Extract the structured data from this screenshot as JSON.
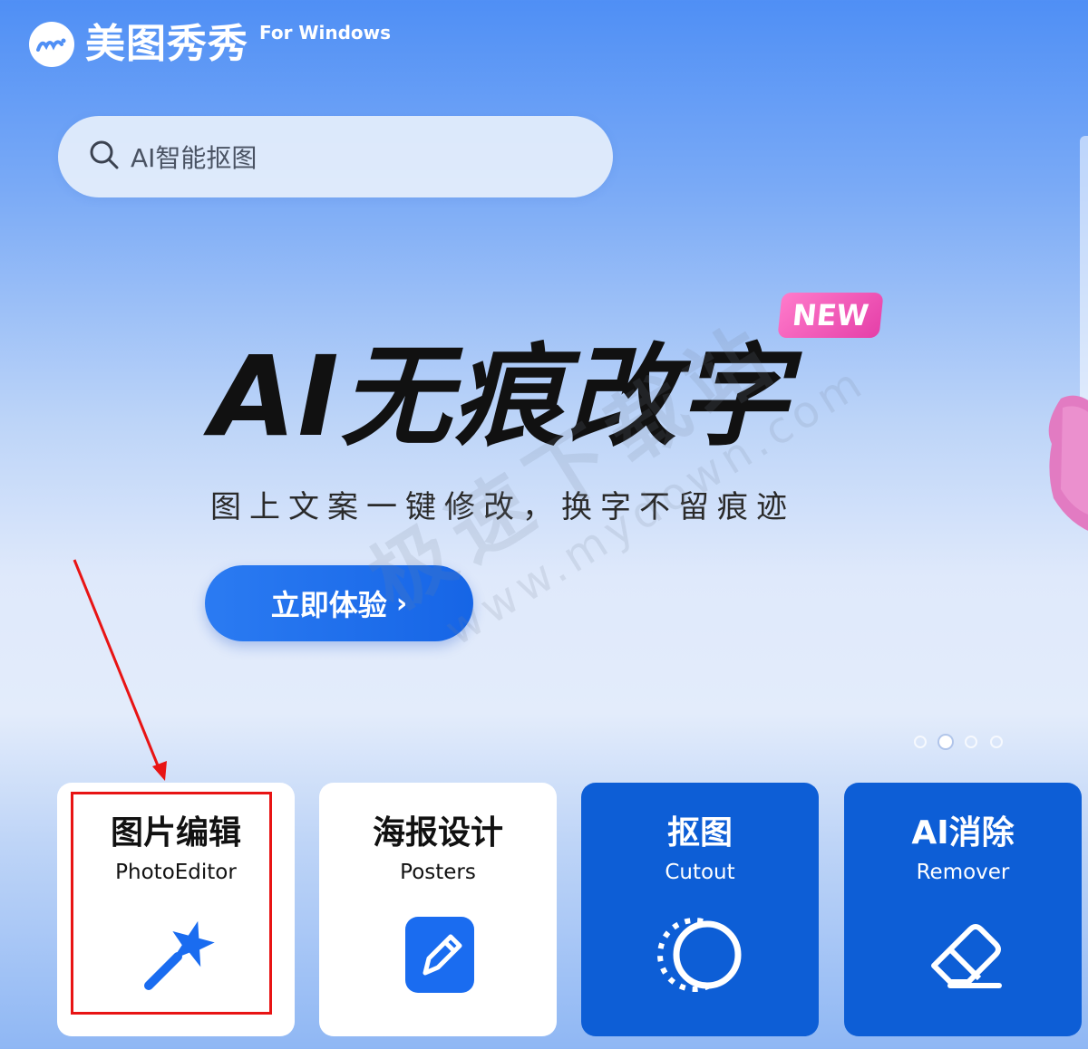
{
  "app": {
    "name": "美图秀秀",
    "platform_label": "For Windows"
  },
  "search": {
    "placeholder": "AI智能抠图"
  },
  "banner": {
    "badge": "NEW",
    "headline": "AI无痕改字",
    "subline": "图上文案一键修改，换字不留痕迹",
    "cta_label": "立即体验",
    "carousel_total": 4,
    "carousel_active_index": 1
  },
  "watermark": {
    "cn": "极速下载站",
    "en": "www.mydown.com"
  },
  "tools": [
    {
      "title": "图片编辑",
      "subtitle": "PhotoEditor",
      "icon": "magic-wand-icon"
    },
    {
      "title": "海报设计",
      "subtitle": "Posters",
      "icon": "edit-pen-icon"
    },
    {
      "title": "抠图",
      "subtitle": "Cutout",
      "icon": "cutout-circle-icon"
    },
    {
      "title": "AI消除",
      "subtitle": "Remover",
      "icon": "eraser-icon"
    }
  ],
  "colors": {
    "accent_blue": "#0d5ed6",
    "cta_blue": "#1665e6",
    "badge_pink": "#e53fa8",
    "annotation_red": "#e81414"
  }
}
